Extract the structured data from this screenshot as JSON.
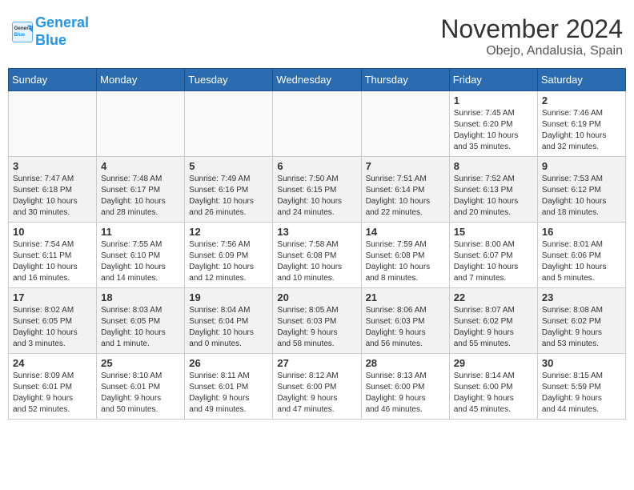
{
  "header": {
    "logo_line1": "General",
    "logo_line2": "Blue",
    "month": "November 2024",
    "location": "Obejo, Andalusia, Spain"
  },
  "weekdays": [
    "Sunday",
    "Monday",
    "Tuesday",
    "Wednesday",
    "Thursday",
    "Friday",
    "Saturday"
  ],
  "weeks": [
    [
      {
        "day": "",
        "info": ""
      },
      {
        "day": "",
        "info": ""
      },
      {
        "day": "",
        "info": ""
      },
      {
        "day": "",
        "info": ""
      },
      {
        "day": "",
        "info": ""
      },
      {
        "day": "1",
        "info": "Sunrise: 7:45 AM\nSunset: 6:20 PM\nDaylight: 10 hours\nand 35 minutes."
      },
      {
        "day": "2",
        "info": "Sunrise: 7:46 AM\nSunset: 6:19 PM\nDaylight: 10 hours\nand 32 minutes."
      }
    ],
    [
      {
        "day": "3",
        "info": "Sunrise: 7:47 AM\nSunset: 6:18 PM\nDaylight: 10 hours\nand 30 minutes."
      },
      {
        "day": "4",
        "info": "Sunrise: 7:48 AM\nSunset: 6:17 PM\nDaylight: 10 hours\nand 28 minutes."
      },
      {
        "day": "5",
        "info": "Sunrise: 7:49 AM\nSunset: 6:16 PM\nDaylight: 10 hours\nand 26 minutes."
      },
      {
        "day": "6",
        "info": "Sunrise: 7:50 AM\nSunset: 6:15 PM\nDaylight: 10 hours\nand 24 minutes."
      },
      {
        "day": "7",
        "info": "Sunrise: 7:51 AM\nSunset: 6:14 PM\nDaylight: 10 hours\nand 22 minutes."
      },
      {
        "day": "8",
        "info": "Sunrise: 7:52 AM\nSunset: 6:13 PM\nDaylight: 10 hours\nand 20 minutes."
      },
      {
        "day": "9",
        "info": "Sunrise: 7:53 AM\nSunset: 6:12 PM\nDaylight: 10 hours\nand 18 minutes."
      }
    ],
    [
      {
        "day": "10",
        "info": "Sunrise: 7:54 AM\nSunset: 6:11 PM\nDaylight: 10 hours\nand 16 minutes."
      },
      {
        "day": "11",
        "info": "Sunrise: 7:55 AM\nSunset: 6:10 PM\nDaylight: 10 hours\nand 14 minutes."
      },
      {
        "day": "12",
        "info": "Sunrise: 7:56 AM\nSunset: 6:09 PM\nDaylight: 10 hours\nand 12 minutes."
      },
      {
        "day": "13",
        "info": "Sunrise: 7:58 AM\nSunset: 6:08 PM\nDaylight: 10 hours\nand 10 minutes."
      },
      {
        "day": "14",
        "info": "Sunrise: 7:59 AM\nSunset: 6:08 PM\nDaylight: 10 hours\nand 8 minutes."
      },
      {
        "day": "15",
        "info": "Sunrise: 8:00 AM\nSunset: 6:07 PM\nDaylight: 10 hours\nand 7 minutes."
      },
      {
        "day": "16",
        "info": "Sunrise: 8:01 AM\nSunset: 6:06 PM\nDaylight: 10 hours\nand 5 minutes."
      }
    ],
    [
      {
        "day": "17",
        "info": "Sunrise: 8:02 AM\nSunset: 6:05 PM\nDaylight: 10 hours\nand 3 minutes."
      },
      {
        "day": "18",
        "info": "Sunrise: 8:03 AM\nSunset: 6:05 PM\nDaylight: 10 hours\nand 1 minute."
      },
      {
        "day": "19",
        "info": "Sunrise: 8:04 AM\nSunset: 6:04 PM\nDaylight: 10 hours\nand 0 minutes."
      },
      {
        "day": "20",
        "info": "Sunrise: 8:05 AM\nSunset: 6:03 PM\nDaylight: 9 hours\nand 58 minutes."
      },
      {
        "day": "21",
        "info": "Sunrise: 8:06 AM\nSunset: 6:03 PM\nDaylight: 9 hours\nand 56 minutes."
      },
      {
        "day": "22",
        "info": "Sunrise: 8:07 AM\nSunset: 6:02 PM\nDaylight: 9 hours\nand 55 minutes."
      },
      {
        "day": "23",
        "info": "Sunrise: 8:08 AM\nSunset: 6:02 PM\nDaylight: 9 hours\nand 53 minutes."
      }
    ],
    [
      {
        "day": "24",
        "info": "Sunrise: 8:09 AM\nSunset: 6:01 PM\nDaylight: 9 hours\nand 52 minutes."
      },
      {
        "day": "25",
        "info": "Sunrise: 8:10 AM\nSunset: 6:01 PM\nDaylight: 9 hours\nand 50 minutes."
      },
      {
        "day": "26",
        "info": "Sunrise: 8:11 AM\nSunset: 6:01 PM\nDaylight: 9 hours\nand 49 minutes."
      },
      {
        "day": "27",
        "info": "Sunrise: 8:12 AM\nSunset: 6:00 PM\nDaylight: 9 hours\nand 47 minutes."
      },
      {
        "day": "28",
        "info": "Sunrise: 8:13 AM\nSunset: 6:00 PM\nDaylight: 9 hours\nand 46 minutes."
      },
      {
        "day": "29",
        "info": "Sunrise: 8:14 AM\nSunset: 6:00 PM\nDaylight: 9 hours\nand 45 minutes."
      },
      {
        "day": "30",
        "info": "Sunrise: 8:15 AM\nSunset: 5:59 PM\nDaylight: 9 hours\nand 44 minutes."
      }
    ]
  ]
}
